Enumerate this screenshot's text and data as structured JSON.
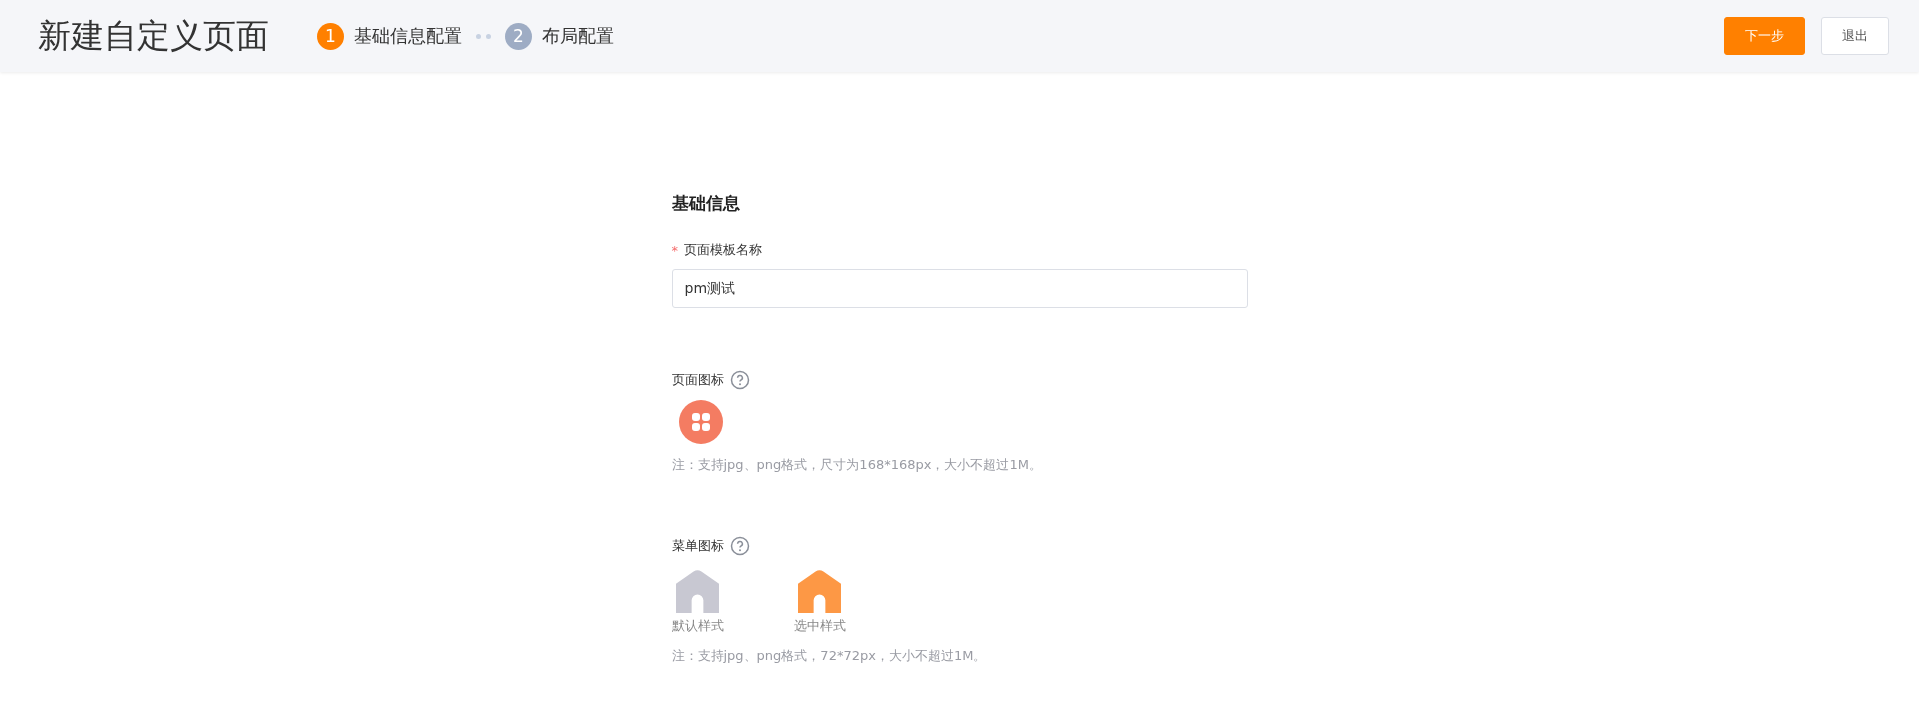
{
  "header": {
    "title": "新建自定义页面",
    "steps": [
      {
        "number": "1",
        "label": "基础信息配置",
        "active": true
      },
      {
        "number": "2",
        "label": "布局配置",
        "active": false
      }
    ],
    "buttons": [
      {
        "label": "下一步",
        "kind": "primary"
      },
      {
        "label": "退出",
        "kind": "default"
      }
    ]
  },
  "form": {
    "section_title": "基础信息",
    "name_field": {
      "label": "页面模板名称",
      "required": true,
      "required_mark": "*",
      "value": "pm测试"
    },
    "page_icon": {
      "label": "页面图标",
      "note": "注：支持jpg、png格式，尺寸为168*168px，大小不超过1M。"
    },
    "menu_icon": {
      "label": "菜单图标",
      "options": [
        {
          "label": "默认样式",
          "selected": false
        },
        {
          "label": "选中样式",
          "selected": true
        }
      ],
      "note": "注：支持jpg、png格式，72*72px，大小不超过1M。"
    }
  }
}
